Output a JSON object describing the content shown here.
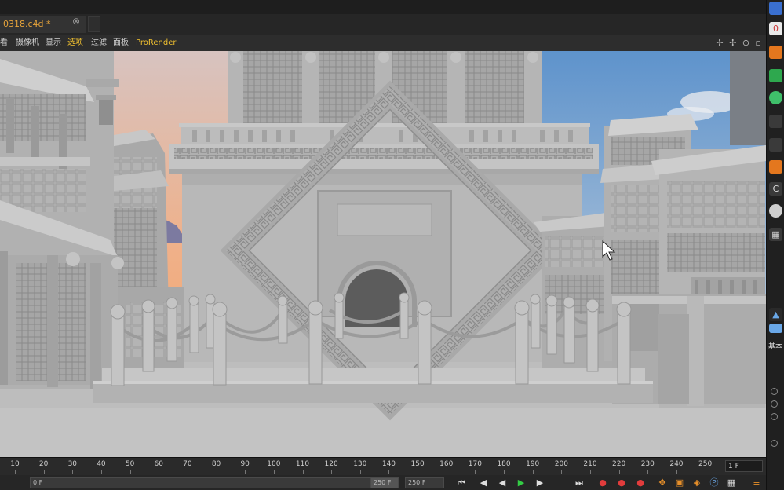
{
  "document": {
    "tab_title": "0318.c4d *",
    "close_glyph": "⊗"
  },
  "menu": {
    "items": [
      {
        "label": "看",
        "state": "normal"
      },
      {
        "label": "摄像机",
        "state": "normal"
      },
      {
        "label": "显示",
        "state": "normal"
      },
      {
        "label": "选项",
        "state": "active"
      },
      {
        "label": "过滤",
        "state": "normal"
      },
      {
        "label": "面板",
        "state": "normal"
      },
      {
        "label": "ProRender",
        "state": "pro"
      }
    ],
    "viewport_icons": "✢ ✢ ⊙ ▫"
  },
  "timeline": {
    "ticks": [
      "10",
      "20",
      "30",
      "40",
      "50",
      "60",
      "70",
      "80",
      "90",
      "100",
      "110",
      "120",
      "130",
      "140",
      "150",
      "160",
      "170",
      "180",
      "190",
      "200",
      "210",
      "220",
      "230",
      "240",
      "250"
    ],
    "current_frame": "1 F"
  },
  "transport": {
    "start_field": "0 F",
    "end_field": "250 F",
    "max_field": "250 F",
    "buttons": [
      "⏮",
      "◀",
      "◀",
      "▶",
      "▶",
      "⏭"
    ]
  },
  "right_panel": {
    "label": "基本"
  },
  "colors": {
    "accent": "#f0c030",
    "play": "#33cc44",
    "record": "#e23c3c",
    "sky_warm": "#f2b48a",
    "sky_blue": "#6d9fd3",
    "model": "#b9b9b9"
  }
}
